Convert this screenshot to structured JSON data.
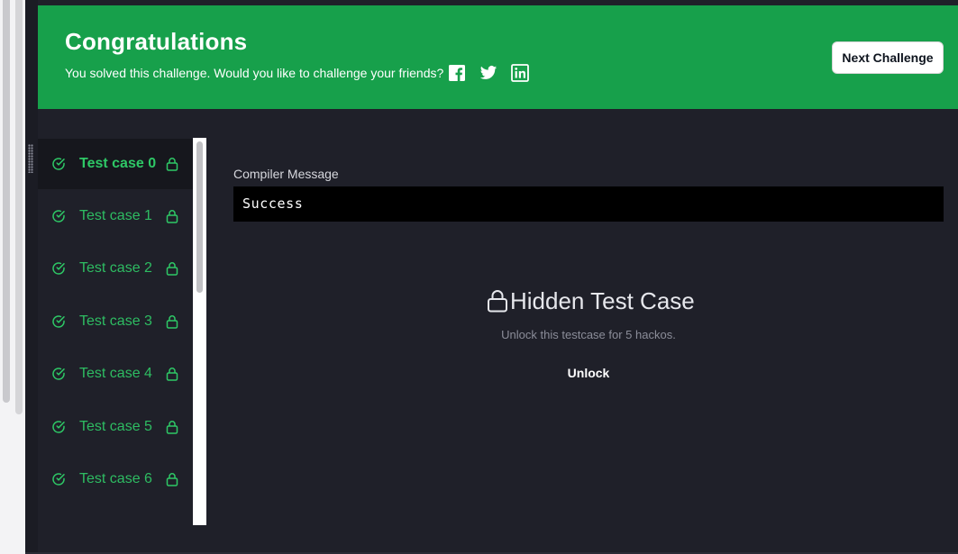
{
  "banner": {
    "title": "Congratulations",
    "subtitle": "You solved this challenge. Would you like to challenge your friends?",
    "share_icons": [
      "facebook-icon",
      "twitter-icon",
      "linkedin-icon"
    ],
    "next_button_label": "Next Challenge",
    "color": "#17a04b"
  },
  "test_cases": {
    "active_index": 0,
    "items": [
      {
        "label": "Test case 0",
        "status": "passed",
        "locked": true
      },
      {
        "label": "Test case 1",
        "status": "passed",
        "locked": true
      },
      {
        "label": "Test case 2",
        "status": "passed",
        "locked": true
      },
      {
        "label": "Test case 3",
        "status": "passed",
        "locked": true
      },
      {
        "label": "Test case 4",
        "status": "passed",
        "locked": true
      },
      {
        "label": "Test case 5",
        "status": "passed",
        "locked": true
      },
      {
        "label": "Test case 6",
        "status": "passed",
        "locked": true
      }
    ],
    "accent": "#2ec866"
  },
  "result": {
    "compiler_label": "Compiler Message",
    "compiler_message": "Success",
    "hidden_title": "Hidden Test Case",
    "hidden_subtitle": "Unlock this testcase for 5 hackos.",
    "unlock_label": "Unlock"
  }
}
